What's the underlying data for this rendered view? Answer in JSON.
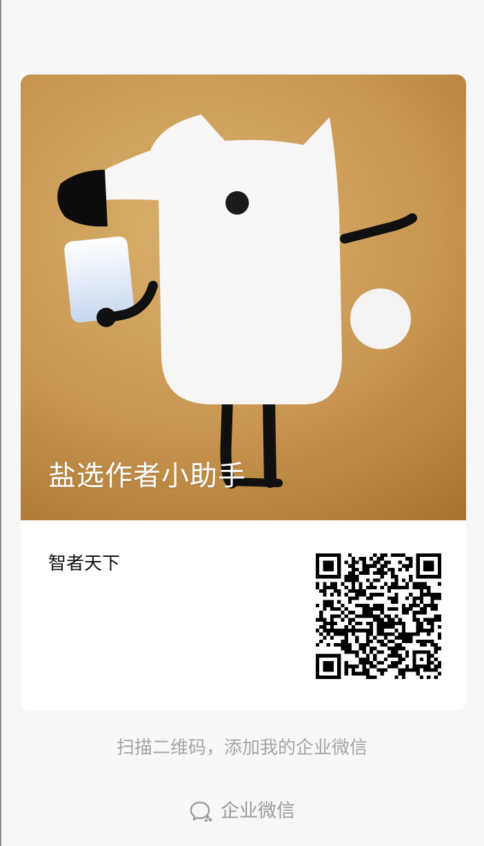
{
  "card": {
    "title": "盐选作者小助手",
    "organization": "智者天下"
  },
  "scan_hint": "扫描二维码，添加我的企业微信",
  "footer": {
    "brand_label": "企业微信",
    "brand_icon": "wecom-chat-icon"
  },
  "colors": {
    "background": "#f7f7f7",
    "card": "#ffffff",
    "hero_gold": "#c89651",
    "hint_gray": "#a6a6a6"
  }
}
